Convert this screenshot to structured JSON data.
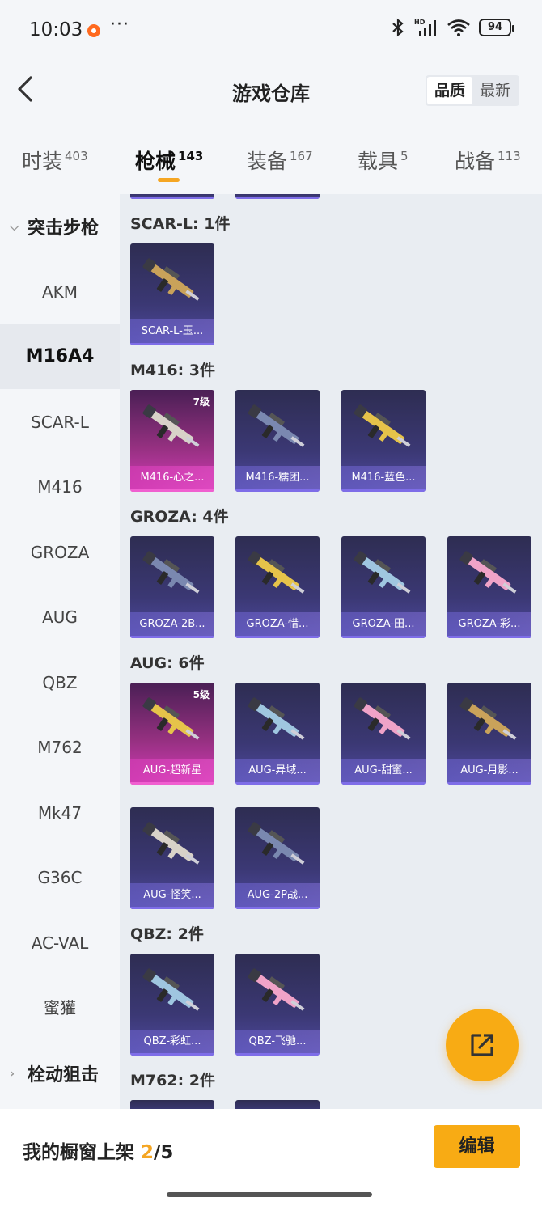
{
  "status_bar": {
    "time": "10:03",
    "more": "···",
    "battery": "94",
    "icons": [
      "notification-dot-icon",
      "bluetooth-icon",
      "signal-icon",
      "wifi-icon",
      "battery-icon"
    ]
  },
  "header": {
    "title": "游戏仓库",
    "sort_options": [
      "品质",
      "最新"
    ],
    "active_sort": "品质"
  },
  "tabs": [
    {
      "label": "时装",
      "count": "403"
    },
    {
      "label": "枪械",
      "count": "143"
    },
    {
      "label": "装备",
      "count": "167"
    },
    {
      "label": "载具",
      "count": "5"
    },
    {
      "label": "战备",
      "count": "113"
    }
  ],
  "active_tab": "枪械",
  "sidebar": {
    "group1": "突击步枪",
    "items": [
      "AKM",
      "M16A4",
      "SCAR-L",
      "M416",
      "GROZA",
      "AUG",
      "QBZ",
      "M762",
      "Mk47",
      "G36C",
      "AC-VAL",
      "蜜獾"
    ],
    "active_item": "M16A4",
    "group2": "栓动狙击"
  },
  "sections": [
    {
      "title": "SCAR-L: 1件",
      "items": [
        {
          "name": "SCAR-L-玉...",
          "rarity": "purple",
          "level": ""
        }
      ]
    },
    {
      "title": "M416: 3件",
      "items": [
        {
          "name": "M416-心之...",
          "rarity": "pink",
          "level": "7级"
        },
        {
          "name": "M416-糯团...",
          "rarity": "purple",
          "level": ""
        },
        {
          "name": "M416-蓝色...",
          "rarity": "purple",
          "level": ""
        }
      ]
    },
    {
      "title": "GROZA: 4件",
      "items": [
        {
          "name": "GROZA-2B...",
          "rarity": "purple",
          "level": ""
        },
        {
          "name": "GROZA-惜...",
          "rarity": "purple",
          "level": ""
        },
        {
          "name": "GROZA-田...",
          "rarity": "purple",
          "level": ""
        },
        {
          "name": "GROZA-彩...",
          "rarity": "purple",
          "level": ""
        }
      ]
    },
    {
      "title": "AUG: 6件",
      "items": [
        {
          "name": "AUG-超新星",
          "rarity": "pink",
          "level": "5级"
        },
        {
          "name": "AUG-异域...",
          "rarity": "purple",
          "level": ""
        },
        {
          "name": "AUG-甜蜜...",
          "rarity": "purple",
          "level": ""
        },
        {
          "name": "AUG-月影...",
          "rarity": "purple",
          "level": ""
        },
        {
          "name": "AUG-怪笑...",
          "rarity": "purple",
          "level": ""
        },
        {
          "name": "AUG-2P战...",
          "rarity": "purple",
          "level": ""
        }
      ]
    },
    {
      "title": "QBZ: 2件",
      "items": [
        {
          "name": "QBZ-彩虹...",
          "rarity": "purple",
          "level": ""
        },
        {
          "name": "QBZ-飞驰...",
          "rarity": "purple",
          "level": ""
        }
      ]
    },
    {
      "title": "M762: 2件",
      "items": []
    }
  ],
  "fab": {
    "icon": "share-icon"
  },
  "bottom_bar": {
    "label": "我的橱窗上架",
    "current": "2",
    "total": "/5",
    "edit_label": "编辑"
  },
  "colors": {
    "accent": "#f8ab14",
    "purple_card": "#3b3874",
    "pink_card": "#d43bb6"
  }
}
